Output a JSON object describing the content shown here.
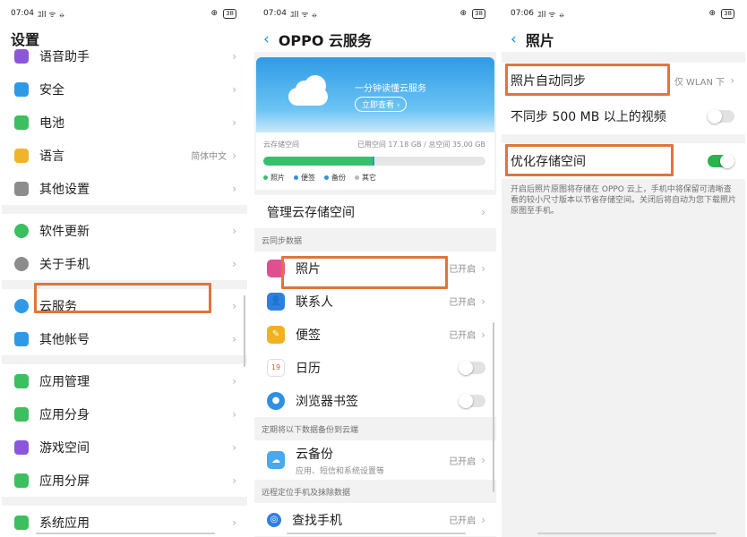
{
  "screen1": {
    "status": {
      "time": "07:04",
      "signal": "ﾕll ᯤ ⦵",
      "battery": "38"
    },
    "title": "设置",
    "groups": [
      [
        {
          "name": "voice-assistant",
          "label": "语音助手",
          "icon": "mic-icon",
          "color": "#8b56d9"
        },
        {
          "name": "security",
          "label": "安全",
          "icon": "shield-icon",
          "color": "#2e9ae6"
        },
        {
          "name": "battery",
          "label": "电池",
          "icon": "battery-icon",
          "color": "#3bbf5f"
        },
        {
          "name": "language",
          "label": "语言",
          "value": "简体中文",
          "icon": "language-icon",
          "color": "#f0b42b"
        },
        {
          "name": "other-settings",
          "label": "其他设置",
          "icon": "gear-icon",
          "color": "#8c8c8c"
        }
      ],
      [
        {
          "name": "software-update",
          "label": "软件更新",
          "icon": "update-icon",
          "color": "#3bbf5f"
        },
        {
          "name": "about-phone",
          "label": "关于手机",
          "icon": "info-icon",
          "color": "#8c8c8c"
        }
      ],
      [
        {
          "name": "cloud-service",
          "label": "云服务",
          "icon": "cloud-icon",
          "color": "#2e9ae6"
        },
        {
          "name": "other-accounts",
          "label": "其他帐号",
          "icon": "person-icon",
          "color": "#2e9ae6"
        }
      ],
      [
        {
          "name": "app-management",
          "label": "应用管理",
          "icon": "apps-icon",
          "color": "#3bbf5f"
        },
        {
          "name": "app-clone",
          "label": "应用分身",
          "icon": "clone-icon",
          "color": "#3bbf5f"
        },
        {
          "name": "game-space",
          "label": "游戏空间",
          "icon": "game-icon",
          "color": "#8b56d9"
        },
        {
          "name": "split-screen",
          "label": "应用分屏",
          "icon": "split-screen-icon",
          "color": "#3bbf5f"
        }
      ],
      [
        {
          "name": "system-apps",
          "label": "系统应用",
          "icon": "system-apps-icon",
          "color": "#3bbf5f"
        }
      ]
    ]
  },
  "screen2": {
    "status": {
      "time": "07:04",
      "signal": "ﾕll ᯤ ⦵",
      "battery": "38"
    },
    "title": "OPPO 云服务",
    "back": "‹",
    "banner": {
      "text": "一分钟读懂云服务",
      "button": "立即查看 ›"
    },
    "storage": {
      "label": "云存储空间",
      "usage": "已用空间 17.18 GB / 总空间 35.00 GB",
      "used_fraction": 0.49,
      "legend": [
        "照片",
        "便签",
        "备份",
        "其它"
      ],
      "legend_colors": [
        "#36c06a",
        "#2f8fe0",
        "#2f8fe0",
        "#b9b9b9"
      ]
    },
    "manage": "管理云存储空间",
    "sync_header": "云同步数据",
    "sync_items": [
      {
        "name": "photos",
        "label": "照片",
        "value": "已开启",
        "icon": "photos-icon",
        "color": "#e0508f"
      },
      {
        "name": "contacts",
        "label": "联系人",
        "value": "已开启",
        "icon": "contacts-icon",
        "color": "#2f7fe0"
      },
      {
        "name": "notes",
        "label": "便签",
        "value": "已开启",
        "icon": "notes-icon",
        "color": "#f2b11f"
      },
      {
        "name": "calendar",
        "label": "日历",
        "toggle": false,
        "icon": "calendar-icon",
        "color": "#ffffff"
      },
      {
        "name": "bookmarks",
        "label": "浏览器书签",
        "toggle": false,
        "icon": "browser-icon",
        "color": "#2f8fe0"
      }
    ],
    "backup_header": "定期将以下数据备份到云端",
    "backup": {
      "label": "云备份",
      "sub": "应用、短信和系统设置等",
      "value": "已开启"
    },
    "find_header": "远程定位手机及抹除数据",
    "find": {
      "label": "查找手机",
      "value": "已开启"
    }
  },
  "screen3": {
    "status": {
      "time": "07:06",
      "signal": "ﾕll ᯤ ⦵",
      "battery": "38"
    },
    "title": "照片",
    "back": "‹",
    "auto_sync": {
      "label": "照片自动同步",
      "value": "仅 WLAN 下"
    },
    "skip_large": {
      "label": "不同步 500 MB 以上的视频",
      "toggle": false
    },
    "optimize": {
      "label": "优化存储空间",
      "toggle": true
    },
    "description": "开启后照片原图将存储在 OPPO 云上，手机中将保留可清晰查看的较小尺寸版本以节省存储空间。关闭后将自动为您下载照片原图至手机。"
  },
  "colors": {
    "accent": "#1a8fd6",
    "highlight": "#e2743b",
    "toggle_on": "#2bb34f"
  }
}
